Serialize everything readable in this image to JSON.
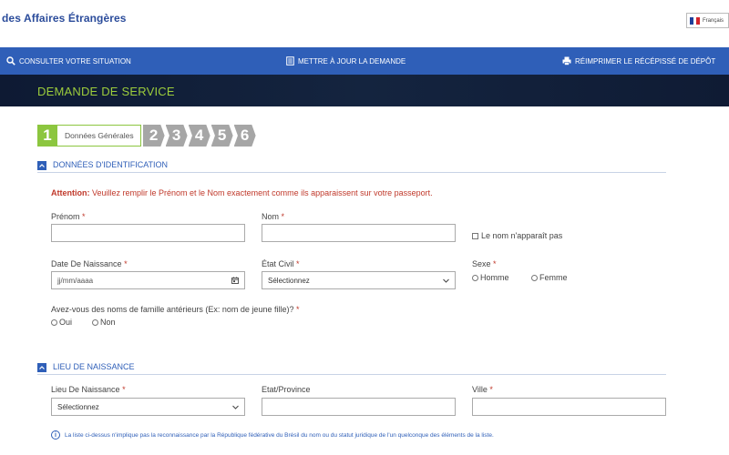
{
  "header": {
    "brand": "des Affaires Étrangères",
    "language": "Français"
  },
  "nav": {
    "items": [
      {
        "label": "CONSULTER VOTRE SITUATION",
        "icon": "search-icon"
      },
      {
        "label": "METTRE À JOUR LA DEMANDE",
        "icon": "document-icon"
      },
      {
        "label": "RÉIMPRIMER LE RÉCÉPISSÉ DE DÉPÔT",
        "icon": "printer-icon"
      }
    ]
  },
  "banner": {
    "title": "DEMANDE DE SERVICE"
  },
  "steps": {
    "active_number": "1",
    "active_label": "Données Générales",
    "others": [
      "2",
      "3",
      "4",
      "5",
      "6"
    ]
  },
  "identification": {
    "title": "DONNÉES D'IDENTIFICATION",
    "attention_prefix": "Attention:",
    "attention_text": " Veuillez remplir le Prénom et le Nom exactement comme ils apparaissent sur votre passeport.",
    "prenom_label": "Prénom",
    "nom_label": "Nom",
    "nom_absent_label": "Le nom n'apparaît pas",
    "birthdate_label": "Date De Naissance",
    "birthdate_placeholder": "jj/mm/aaaa",
    "civil_label": "État Civil",
    "civil_value": "Sélectionnez",
    "sex_label": "Sexe",
    "sex_options": [
      "Homme",
      "Femme"
    ],
    "former_names_label": "Avez-vous des noms de famille antérieurs (Ex: nom de jeune fille)?",
    "former_names_options": [
      "Oui",
      "Non"
    ],
    "required_mark": "*"
  },
  "birthplace": {
    "title": "LIEU DE NAISSANCE",
    "place_label": "Lieu De Naissance",
    "place_value": "Sélectionnez",
    "state_label": "Etat/Province",
    "city_label": "Ville",
    "disclaimer": "La liste ci-dessus n'implique pas la reconnaissance par la République fédérative du Brésil du nom ou du statut juridique de l'un quelconque des éléments de la liste."
  },
  "colors": {
    "nav_blue": "#2f5fb8",
    "step_green": "#8cc63f",
    "step_gray": "#a6a6a6",
    "warning_red": "#c0392b",
    "banner_dark": "#0e1a33",
    "banner_title": "#9ccc3c"
  }
}
